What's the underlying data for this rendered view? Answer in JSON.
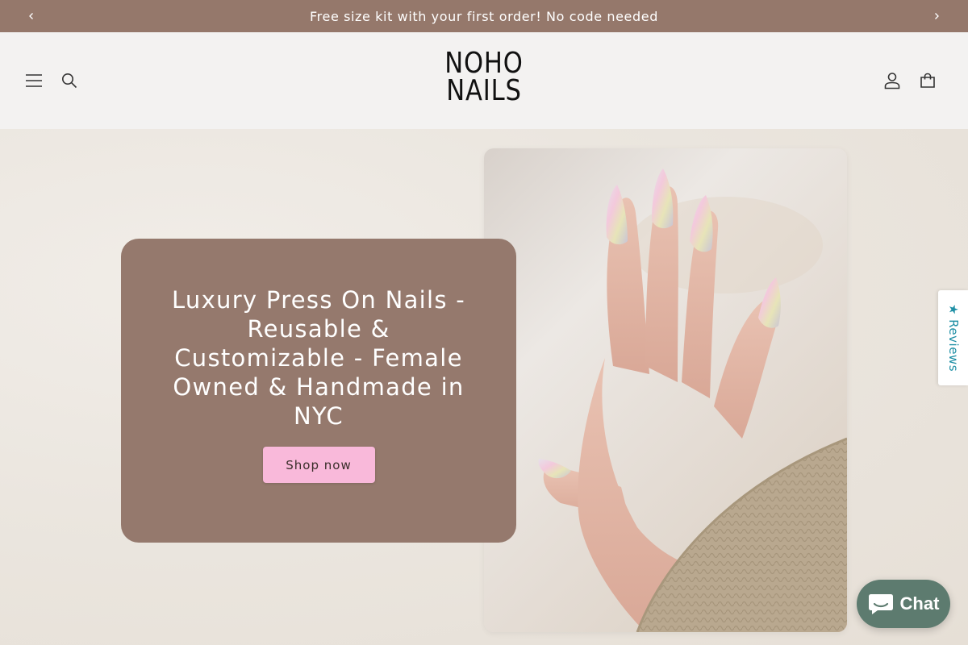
{
  "announcement": {
    "text": "Free size kit with your first order! No code needed",
    "prev_icon": "chevron-left-icon",
    "next_icon": "chevron-right-icon"
  },
  "header": {
    "menu_icon": "hamburger-menu-icon",
    "search_icon": "search-icon",
    "logo_line1": "NOHO",
    "logo_line2": "NAILS",
    "account_icon": "account-icon",
    "cart_icon": "cart-icon"
  },
  "hero": {
    "title": "Luxury Press On Nails - Reusable & Customizable - Female Owned & Handmade in NYC",
    "button_label": "Shop now",
    "image": "hand-with-iridescent-almond-nails"
  },
  "reviews_tab": {
    "label": "★ Reviews"
  },
  "chat": {
    "label": "Chat",
    "icon": "chat-bubble-icon"
  },
  "colors": {
    "announcement_bg": "#95786b",
    "card_bg": "#95796d",
    "button_bg": "#f9b9da",
    "chat_bg": "#5d7b6f",
    "reviews_text": "#1e8fa5"
  }
}
